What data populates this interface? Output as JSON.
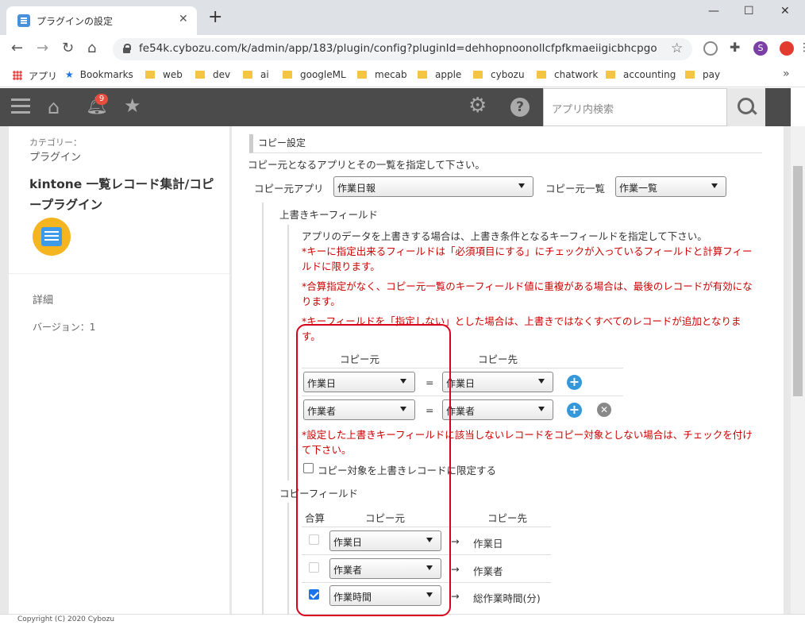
{
  "browser": {
    "tab_title": "プラグインの設定",
    "tab_close": "✕",
    "new_tab": "+",
    "win_min": "—",
    "win_max": "☐",
    "win_close": "✕",
    "url": "fe54k.cybozu.com/k/admin/app/183/plugin/config?pluginId=dehhopnoonollcfpfkmaeiigicbhcpgo",
    "profile_initial": "S",
    "bookmarks": [
      "アプリ",
      "Bookmarks",
      "web",
      "dev",
      "ai",
      "googleML",
      "mecab",
      "apple",
      "cybozu",
      "chatwork",
      "accounting",
      "pay"
    ],
    "bookmarks_more": "»"
  },
  "kintone": {
    "notification_count": "9",
    "search_placeholder": "アプリ内検索",
    "help_label": "?"
  },
  "left": {
    "category_label": "カテゴリー：",
    "category_value": "プラグイン",
    "plugin_name": "kintone 一覧レコード集計/コピープラグイン",
    "detail_label": "詳細",
    "version_label": "バージョン：1"
  },
  "main": {
    "section_title": "コピー設定",
    "intro": "コピー元となるアプリとその一覧を指定して下さい。",
    "source_app_label": "コピー元アプリ",
    "source_app_value": "作業日報",
    "source_view_label": "コピー元一覧",
    "source_view_value": "作業一覧",
    "overwrite_title": "上書きキーフィールド",
    "overwrite_desc": "アプリのデータを上書きする場合は、上書き条件となるキーフィールドを指定して下さい。",
    "note1": "*キーに指定出来るフィールドは「必須項目にする」にチェックが入っているフィールドと計算フィールドに限ります。",
    "note2": "*合算指定がなく、コピー元一覧のキーフィールド値に重複がある場合は、最後のレコードが有効になります。",
    "note3": "*キーフィールドを「指定しない」とした場合は、上書きではなくすべてのレコードが追加となります。",
    "key_col_source": "コピー元",
    "key_col_dest": "コピー先",
    "key_rows": [
      {
        "source": "作業日",
        "eq": "=",
        "dest": "作業日"
      },
      {
        "source": "作業者",
        "eq": "=",
        "dest": "作業者"
      }
    ],
    "note4": "*設定した上書きキーフィールドに該当しないレコードをコピー対象としない場合は、チェックを付けて下さい。",
    "limit_checkbox_label": "コピー対象を上書きレコードに限定する",
    "copy_fields_title": "コピーフィールド",
    "cf_col_sum": "合算",
    "cf_col_source": "コピー元",
    "cf_col_dest": "コピー先",
    "copy_rows": [
      {
        "checked": false,
        "source": "作業日",
        "arrow": "→",
        "dest": "作業日"
      },
      {
        "checked": false,
        "source": "作業者",
        "arrow": "→",
        "dest": "作業者"
      },
      {
        "checked": true,
        "source": "作業時間",
        "arrow": "→",
        "dest": "総作業時間(分)"
      }
    ]
  },
  "footer": {
    "copyright": "Copyright (C) 2020 Cybozu"
  },
  "colors": {
    "highlight_box": "#d9001b",
    "note_text": "#cc0000",
    "header_bg": "#4b4b4b"
  }
}
